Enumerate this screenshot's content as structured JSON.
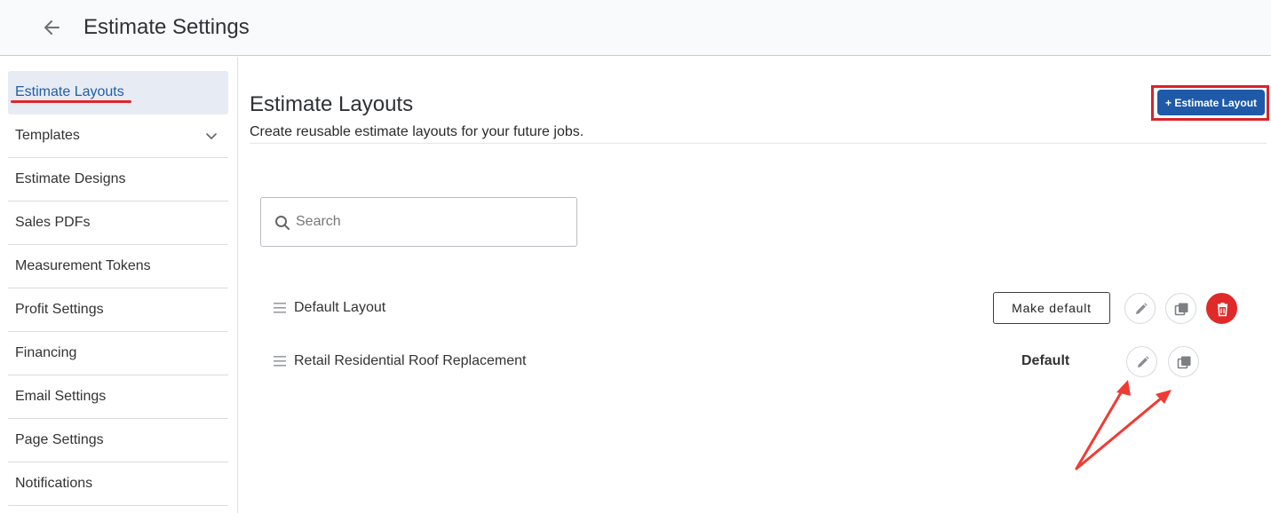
{
  "header": {
    "title": "Estimate Settings",
    "back_icon": "arrow-left-icon"
  },
  "sidebar": {
    "items": [
      {
        "label": "Estimate Layouts",
        "active": true
      },
      {
        "label": "Templates",
        "expandable": true
      },
      {
        "label": "Estimate Designs"
      },
      {
        "label": "Sales PDFs"
      },
      {
        "label": "Measurement Tokens"
      },
      {
        "label": "Profit Settings"
      },
      {
        "label": "Financing"
      },
      {
        "label": "Email Settings"
      },
      {
        "label": "Page Settings"
      },
      {
        "label": "Notifications"
      }
    ]
  },
  "main": {
    "title": "Estimate Layouts",
    "subtitle": "Create reusable estimate layouts for your future jobs.",
    "add_button": "+ Estimate Layout",
    "search": {
      "placeholder": "Search",
      "value": ""
    },
    "layouts": [
      {
        "name": "Default Layout",
        "action_label": "Make default",
        "deletable": true
      },
      {
        "name": "Retail Residential Roof Replacement",
        "status_label": "Default",
        "deletable": false
      }
    ]
  },
  "colors": {
    "accent": "#1e5aa8",
    "active_item_bg": "#e7ebf3",
    "annotation_red": "#e0262b",
    "delete_red": "#e02a2a"
  }
}
